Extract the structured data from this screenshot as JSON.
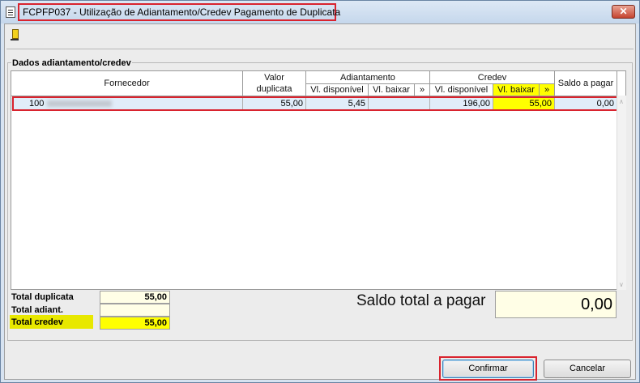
{
  "window": {
    "title": "FCPFP037 - Utilização de Adiantamento/Credev Pagamento de Duplicata",
    "close": "✕"
  },
  "toolbar": {
    "exit_icon": "door-exit-icon"
  },
  "group": {
    "label": "Dados adiantamento/credev"
  },
  "table": {
    "headers": {
      "fornecedor": "Fornecedor",
      "valor_duplicata_1": "Valor",
      "valor_duplicata_2": "duplicata",
      "adiantamento": "Adiantamento",
      "adiant_vl_disponivel": "Vl. disponível",
      "adiant_vl_baixar": "Vl. baixar",
      "adiant_arrow": "»",
      "credev": "Credev",
      "credev_vl_disponivel": "Vl. disponível",
      "credev_vl_baixar": "Vl. baixar",
      "credev_arrow": "»",
      "saldo_a_pagar": "Saldo a pagar"
    },
    "rows": [
      {
        "fornecedor_codigo": "100",
        "valor_duplicata": "55,00",
        "adiant_vl_disponivel": "5,45",
        "adiant_vl_baixar": "",
        "credev_vl_disponivel": "196,00",
        "credev_vl_baixar": "55,00",
        "saldo_a_pagar": "0,00"
      }
    ]
  },
  "totals": {
    "duplicata_label": "Total duplicata",
    "duplicata_value": "55,00",
    "adiant_label": "Total adiant.",
    "adiant_value": "",
    "credev_label": "Total credev",
    "credev_value": "55,00"
  },
  "saldo": {
    "label": "Saldo total a pagar",
    "value": "0,00"
  },
  "buttons": {
    "confirm": "Confirmar",
    "cancel": "Cancelar"
  },
  "colors": {
    "highlight": "#ffff00",
    "annotation": "#d9232e",
    "row_selected": "#e1edf9"
  }
}
